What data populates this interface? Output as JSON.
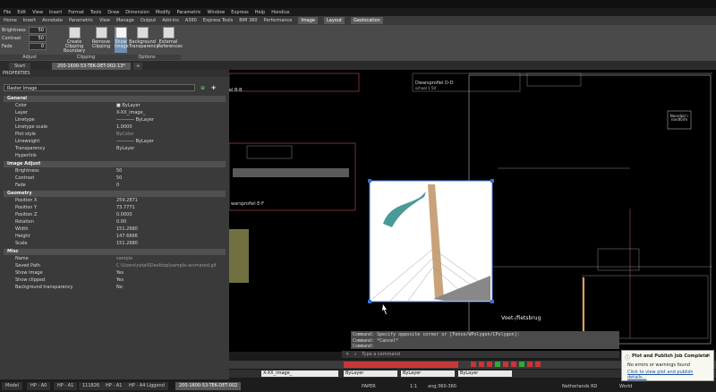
{
  "menu": [
    "File",
    "Edit",
    "View",
    "Insert",
    "Format",
    "Tools",
    "Draw",
    "Dimension",
    "Modify",
    "Parametric",
    "Window",
    "Express",
    "Help",
    "Hondius"
  ],
  "ribbon_tabs": [
    "Home",
    "Insert",
    "Annotate",
    "Parametric",
    "View",
    "Manage",
    "Output",
    "Add-ins",
    "A360",
    "Express Tools",
    "BIM 360",
    "Performance",
    "Image",
    "Layout",
    "Geolocation"
  ],
  "ribbon_active_tab": "Image",
  "adjust": {
    "brightness_label": "Brightness",
    "brightness": "50",
    "contrast_label": "Contrast",
    "contrast": "50",
    "fade_label": "Fade",
    "fade": "0",
    "panel_label": "Adjust"
  },
  "clipping": {
    "create_label": "Create Clipping Boundary",
    "remove_label": "Remove Clipping",
    "panel_label": "Clipping"
  },
  "options": {
    "show_image_label": "Show Image",
    "bg_transparency_label": "Background Transparency",
    "external_refs_label": "External References",
    "panel_label": "Options"
  },
  "file_tabs": {
    "start": "Start",
    "drawing": "200-1600-53-TEK-DET-002-13*"
  },
  "properties": {
    "header": "PROPERTIES",
    "selected": "Raster Image",
    "general_title": "General",
    "general": [
      {
        "k": "Color",
        "v": "■ ByLayer"
      },
      {
        "k": "Layer",
        "v": "X-XX_image_"
      },
      {
        "k": "Linetype",
        "v": "———— ByLayer"
      },
      {
        "k": "Linetype scale",
        "v": "1.0000"
      },
      {
        "k": "Plot style",
        "v": "ByColor"
      },
      {
        "k": "Lineweight",
        "v": "———— ByLayer"
      },
      {
        "k": "Transparency",
        "v": "ByLayer"
      },
      {
        "k": "Hyperlink",
        "v": ""
      }
    ],
    "image_adjust_title": "Image Adjust",
    "image_adjust": [
      {
        "k": "Brightness",
        "v": "50"
      },
      {
        "k": "Contrast",
        "v": "50"
      },
      {
        "k": "Fade",
        "v": "0"
      }
    ],
    "geometry_title": "Geometry",
    "geometry": [
      {
        "k": "Position X",
        "v": "259.2871"
      },
      {
        "k": "Position Y",
        "v": "73.7771"
      },
      {
        "k": "Position Z",
        "v": "0.0000"
      },
      {
        "k": "Rotation",
        "v": "0.00"
      },
      {
        "k": "Width",
        "v": "151.2680"
      },
      {
        "k": "Height",
        "v": "147.6666"
      },
      {
        "k": "Scale",
        "v": "151.2680"
      }
    ],
    "misc_title": "Misc",
    "misc": [
      {
        "k": "Name",
        "v": "sample"
      },
      {
        "k": "Saved Path",
        "v": "C:\\Users\\nstall\\Desktop\\sample-animated.gif"
      },
      {
        "k": "Show image",
        "v": "Yes"
      },
      {
        "k": "Show clipped",
        "v": "Yes"
      },
      {
        "k": "Background transparency",
        "v": "No"
      }
    ]
  },
  "drawing": {
    "section_bd": "Dwarsprofiel D-D",
    "section_bd_scale": "schaal 1:50",
    "section_b": "el B-B",
    "section_ef": "warsprofiel E-F",
    "title_block_name": "Voet-/fietsbrug",
    "north_text": "Noordpijl / rondform",
    "command_history": [
      "Command: Specify opposite corner or [Fence/WPolygon/CPolygon]:",
      "Command: *Cancel*",
      "Command:"
    ],
    "command_placeholder": "Type a command"
  },
  "toolbar": {
    "layer": "X-XX_image_",
    "bylayer1": "ByLayer",
    "bylayer2": "ByLayer",
    "bylayer3": "ByLayer",
    "color_dd": ""
  },
  "status": {
    "layouts": [
      "Model",
      "HP - A0",
      "HP - A1",
      "111826",
      "HP - A1",
      "HP - A4 Liggend",
      "200-1600-53-TEK-DET-002"
    ],
    "active_layout": "200-1600-53-TEK-DET-002",
    "paper": "PAPER",
    "scale": "1:1",
    "coord": "ang:360-360",
    "region": "Netherlands RD",
    "world": "World"
  },
  "notification": {
    "title": "Plot and Publish Job Complete",
    "line1": "No errors or warnings found",
    "link": "Click to view plot and publish details..."
  }
}
